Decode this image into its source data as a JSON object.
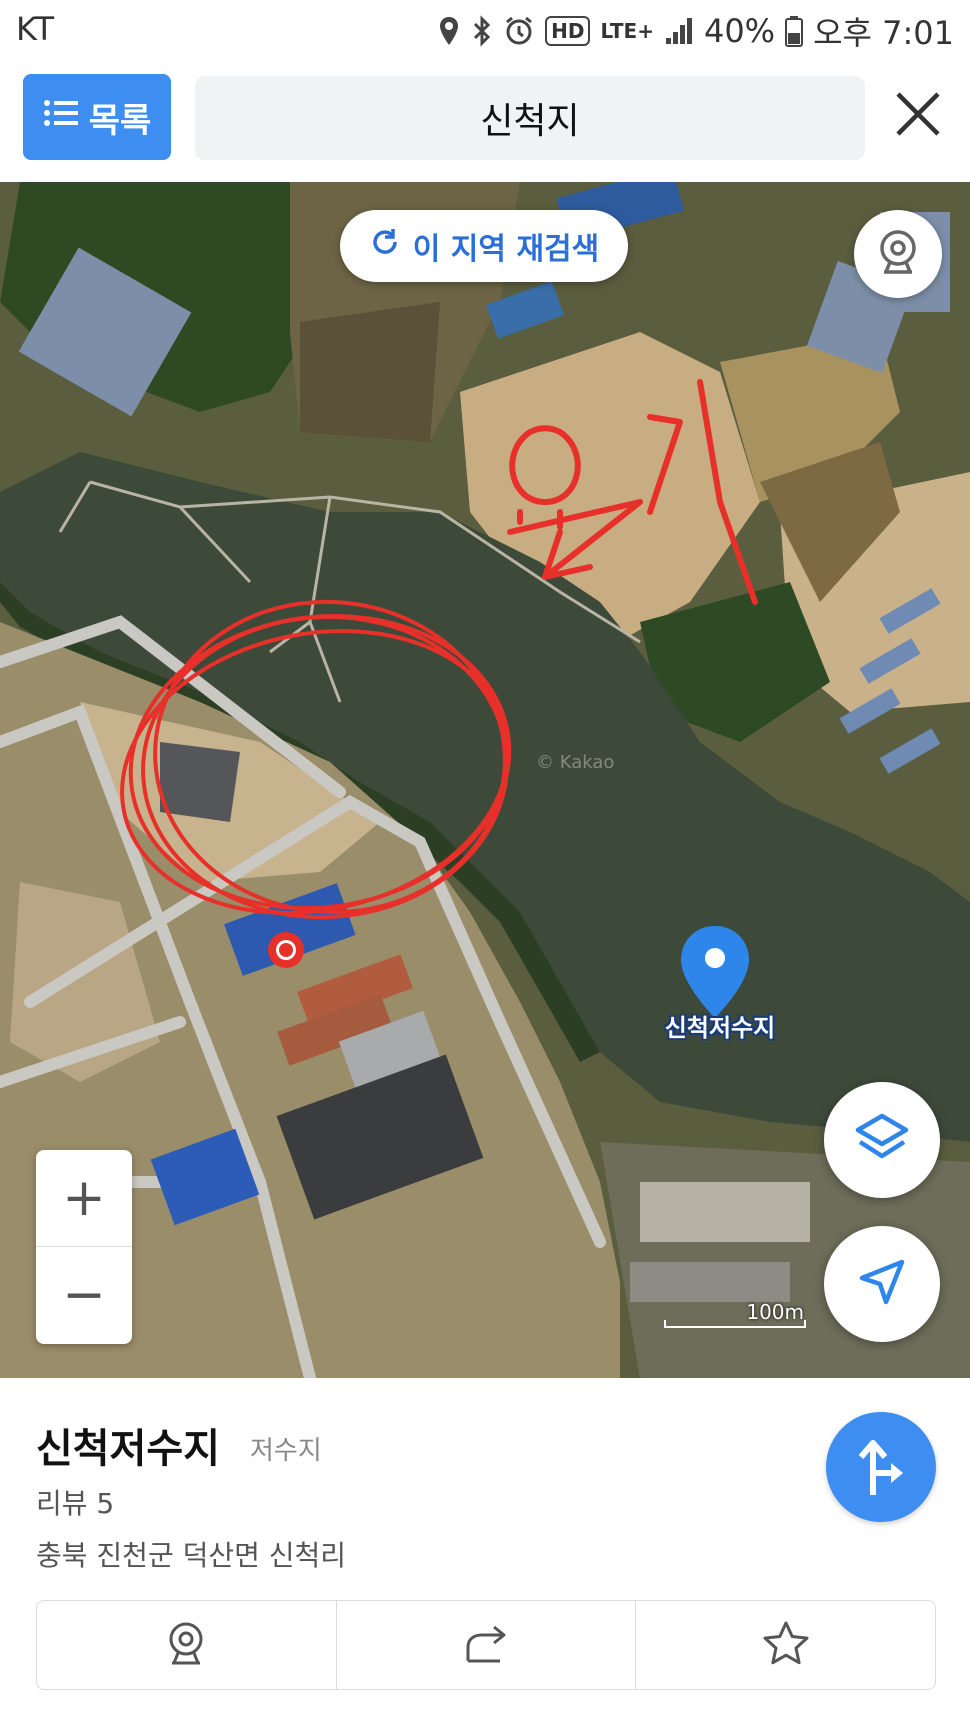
{
  "status_bar": {
    "carrier": "KT",
    "hd_label": "HD",
    "network": "LTE+",
    "battery": "40%",
    "time": "오후 7:01"
  },
  "top_bar": {
    "list_button_label": "목록",
    "search_query": "신척지",
    "close_icon": "close-icon"
  },
  "map": {
    "research_label": "이 지역 재검색",
    "zoom_in_label": "+",
    "zoom_out_label": "−",
    "scale_label": "100m",
    "poi_label": "신척저수지",
    "watermark": "© Kakao",
    "handwritten_annotation": "요기",
    "icons": [
      "refresh-icon",
      "roadview-icon",
      "layers-icon",
      "navigate-icon",
      "map-pin-icon"
    ]
  },
  "place": {
    "name": "신척저수지",
    "category": "저수지",
    "review": "리뷰 5",
    "address": "충북 진천군 덕산면 신척리"
  },
  "actions": {
    "icons": [
      "roadview-icon",
      "share-icon",
      "star-icon",
      "route-icon"
    ]
  },
  "colors": {
    "accent": "#3d8ef0",
    "annotation": "#e8302a",
    "water": "#3d4a3a"
  }
}
